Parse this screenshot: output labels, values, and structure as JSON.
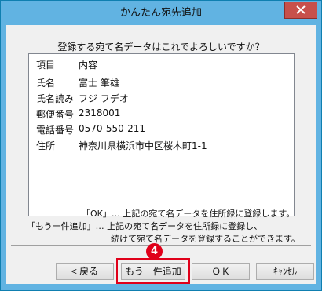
{
  "window": {
    "title": "かんたん宛先追加"
  },
  "dialog": {
    "question": "登録する宛て名データはこれでよろしいですか？",
    "list": {
      "headers": [
        "項目",
        "内容"
      ],
      "rows": [
        {
          "key": "氏名",
          "value": "富士 筆雄"
        },
        {
          "key": "氏名読み",
          "value": "フジ フデオ"
        },
        {
          "key": "郵便番号",
          "value": "2318001"
        },
        {
          "key": "電話番号",
          "value": "0570-550-211"
        },
        {
          "key": "住所",
          "value": "神奈川県横浜市中区桜木町1-1"
        }
      ]
    },
    "notes": {
      "ok_line": "「OK」… 上記の宛て名データを住所録に登録します。",
      "more_line1": "「もう一件追加」… 上記の宛て名データを住所録に登録し、",
      "more_line2": "続けて宛て名データを登録することができます。"
    }
  },
  "buttons": {
    "back": "< 戻る",
    "add_more": "もう一件追加",
    "ok": "O K",
    "cancel": "ｷｬﾝｾﾙ"
  },
  "annotation": {
    "step": "4"
  },
  "colors": {
    "titlebar": "#61b3e2",
    "close": "#c7504b",
    "highlight": "#e0001a"
  }
}
